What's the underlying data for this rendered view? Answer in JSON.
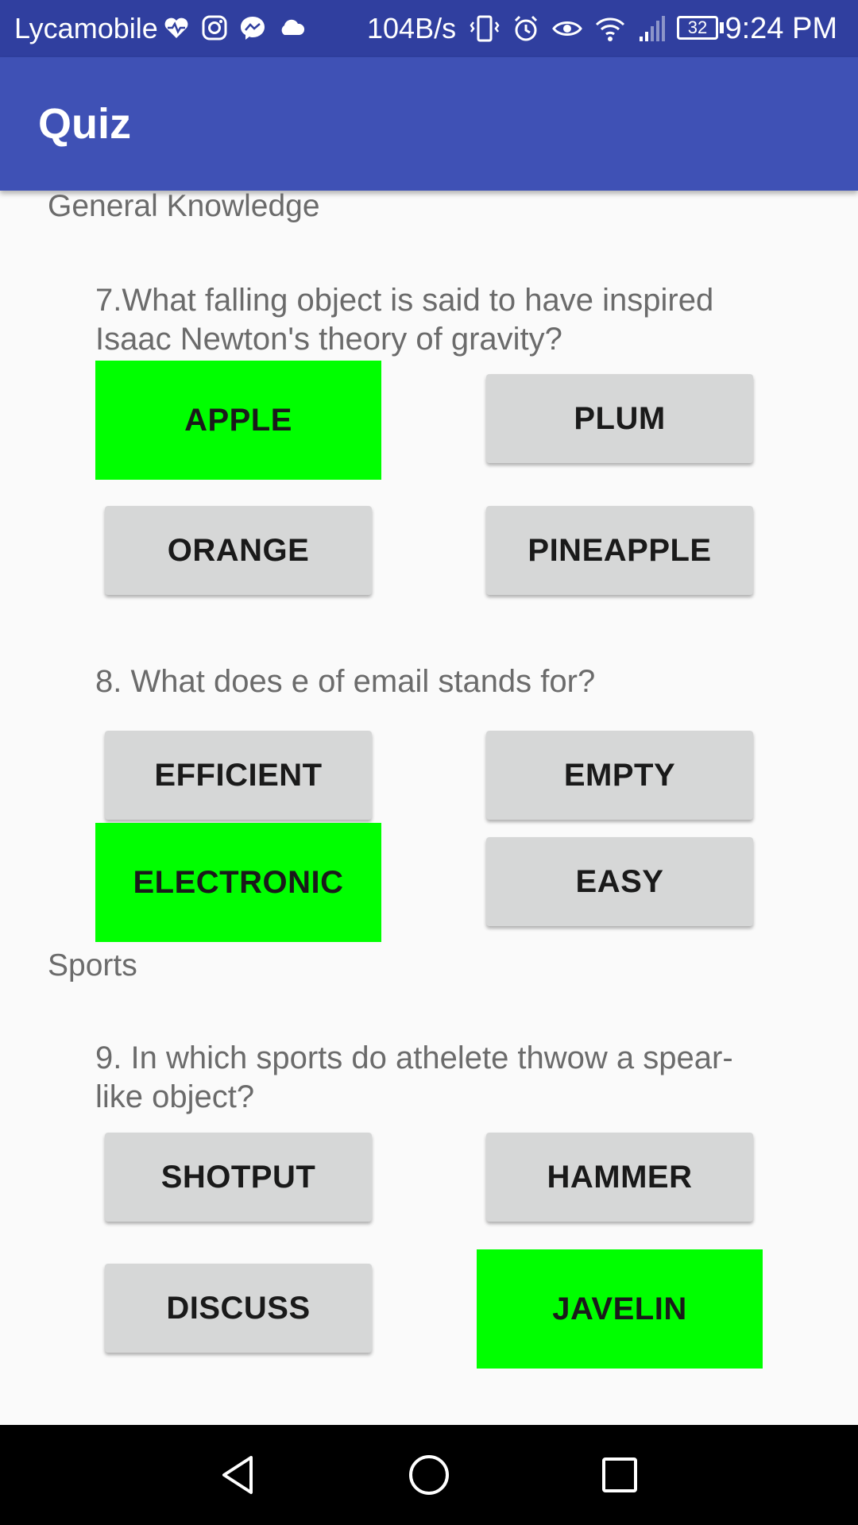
{
  "status_bar": {
    "carrier": "Lycamobile",
    "net_speed": "104B/s",
    "battery_level": "32",
    "time": "9:24 PM",
    "left_icons": [
      "heart-pulse-icon",
      "instagram-icon",
      "messenger-icon",
      "cloud-icon"
    ],
    "right_icons": [
      "vibrate-icon",
      "alarm-icon",
      "eye-icon",
      "wifi-icon",
      "signal-icon",
      "battery-icon"
    ]
  },
  "app_bar": {
    "title": "Quiz"
  },
  "sections": [
    {
      "label": "General Knowledge",
      "questions": [
        {
          "text": "7.What falling object is said to have inspired Isaac Newton's theory of gravity?",
          "options": [
            "APPLE",
            "PLUM",
            "ORANGE",
            "PINEAPPLE"
          ],
          "correct": "APPLE"
        },
        {
          "text": "8. What does e of email stands for?",
          "options": [
            "EFFICIENT",
            "EMPTY",
            "ELECTRONIC",
            "EASY"
          ],
          "correct": "ELECTRONIC"
        }
      ]
    },
    {
      "label": "Sports",
      "questions": [
        {
          "text": "9. In which sports do athelete thwow a spear-like object?",
          "options": [
            "SHOTPUT",
            "HAMMER",
            "DISCUSS",
            "JAVELIN"
          ],
          "correct": "JAVELIN"
        }
      ]
    }
  ],
  "nav_bar": {
    "icons": [
      "back-icon",
      "home-icon",
      "recents-icon"
    ]
  },
  "colors": {
    "status_bar": "#303f9f",
    "app_bar": "#3f51b5",
    "correct": "#00ff00",
    "button": "#d6d7d7"
  }
}
